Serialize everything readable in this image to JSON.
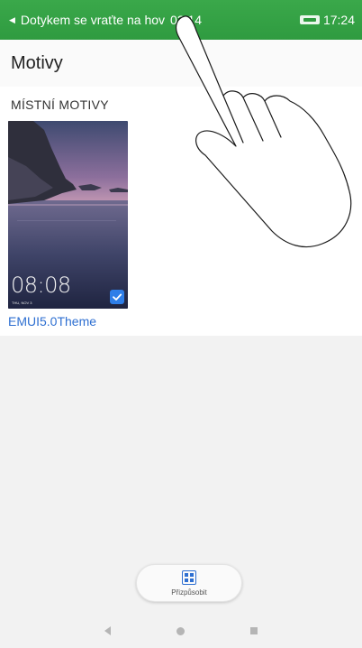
{
  "status_bar": {
    "return_text": "Dotykem se vraťte na hov",
    "call_time": "03:14",
    "clock": "17:24",
    "icons": [
      "back-arrow-icon",
      "battery-icon"
    ]
  },
  "header": {
    "title": "Motivy"
  },
  "section": {
    "title": "MÍSTNÍ MOTIVY"
  },
  "theme": {
    "name": "EMUI5.0Theme",
    "preview_time": "08:08",
    "preview_date": "THU, NOV 3",
    "selected": true
  },
  "actions": {
    "customize_label": "Přizpůsobit"
  },
  "colors": {
    "status_bar": "#2f9b40",
    "accent": "#2e6fd1",
    "check": "#2e7ee8",
    "background": "#f2f2f2"
  },
  "nav_icons": [
    "nav-back-icon",
    "nav-home-icon",
    "nav-recent-icon"
  ]
}
